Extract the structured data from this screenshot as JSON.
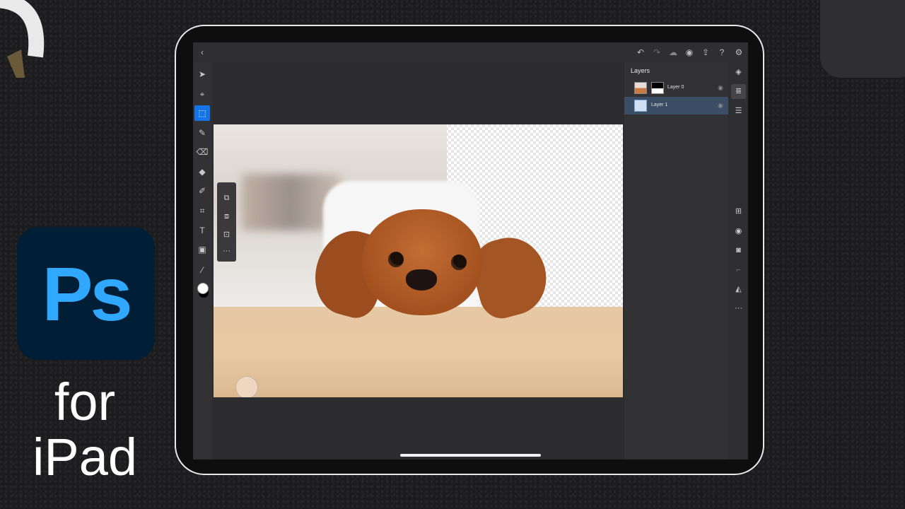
{
  "logo": {
    "text": "Ps",
    "bg_color": "#001e36",
    "text_color": "#31a8ff"
  },
  "caption": {
    "line1": "for",
    "line2": "iPad"
  },
  "topbar": {
    "icons": [
      "back-chevron-icon",
      "undo-icon",
      "redo-icon",
      "cloud-icon",
      "person-icon",
      "share-icon",
      "help-icon",
      "settings-icon"
    ]
  },
  "tools": [
    "move-icon",
    "transform-icon",
    "marquee-select-icon",
    "brush-icon",
    "eraser-icon",
    "fill-icon",
    "eyedropper-healing-icon",
    "crop-icon",
    "type-icon",
    "place-image-icon",
    "eyedropper-icon"
  ],
  "selection_options": [
    "selection-add-icon",
    "selection-subtract-icon",
    "selection-intersect-icon",
    "more-options-icon"
  ],
  "layers": {
    "title": "Layers",
    "items": [
      {
        "name": "Layer 0",
        "selected": false
      },
      {
        "name": "Layer 1",
        "selected": true
      }
    ]
  },
  "right_strip": {
    "top": [
      "layer-stack-icon",
      "layers-panel-icon",
      "adjustments-icon"
    ],
    "bottom": [
      "add-layer-icon",
      "visibility-icon",
      "mask-icon",
      "clip-icon",
      "fill-opacity-icon",
      "more-icon"
    ]
  },
  "colors": {
    "accent": "#1473e6",
    "selected_layer": "#3c4e66",
    "foreground_swatch": "#ffffff",
    "background_swatch": "#000000"
  }
}
